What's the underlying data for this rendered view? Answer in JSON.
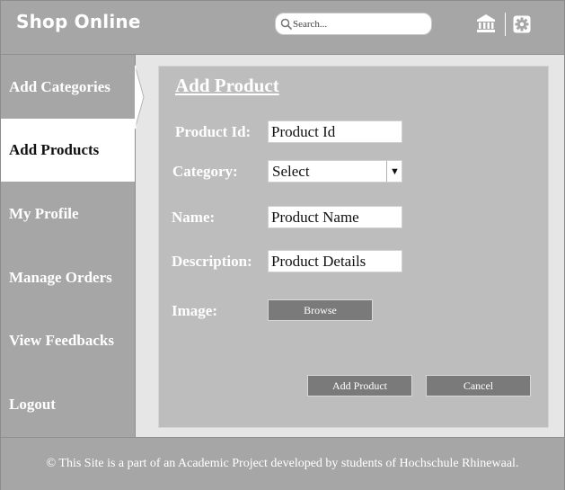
{
  "header": {
    "brand": "Shop Online",
    "search_placeholder": "Search...",
    "icons": [
      "search-icon",
      "bank-icon",
      "gear-icon"
    ]
  },
  "sidebar": {
    "items": [
      {
        "label": "Add Categories",
        "active": false
      },
      {
        "label": "Add Products",
        "active": true
      },
      {
        "label": "My Profile",
        "active": false
      },
      {
        "label": "Manage Orders",
        "active": false
      },
      {
        "label": "View Feedbacks",
        "active": false
      },
      {
        "label": "Logout",
        "active": false
      }
    ]
  },
  "form": {
    "title": "Add Product",
    "product_id_label": "Product Id:",
    "product_id_placeholder": "Product Id",
    "category_label": "Category:",
    "category_value": "Select",
    "name_label": "Name:",
    "name_placeholder": "Product Name",
    "description_label": "Description:",
    "description_placeholder": "Product Details",
    "image_label": "Image:",
    "browse_label": "Browse",
    "submit_label": "Add Product",
    "cancel_label": "Cancel"
  },
  "footer": {
    "text": "© This Site is a part of an Academic Project developed by students of Hochschule Rhinewaal."
  },
  "colors": {
    "chrome": "#a6a6a6",
    "panel": "#bdbdbd",
    "button": "#7a7a7a"
  }
}
